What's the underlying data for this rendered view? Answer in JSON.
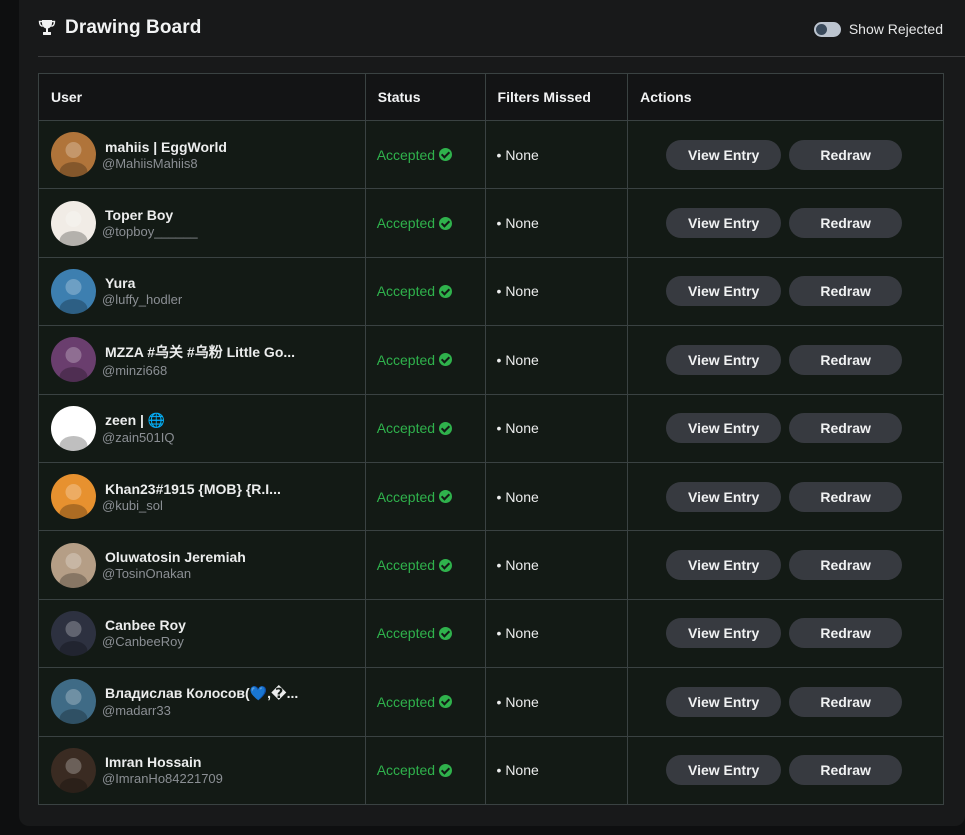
{
  "header": {
    "title": "Drawing Board",
    "toggle_label": "Show Rejected"
  },
  "table": {
    "columns": [
      "User",
      "Status",
      "Filters Missed",
      "Actions"
    ],
    "rows": [
      {
        "name": "mahiis | EggWorld",
        "handle": "@MahiisMahiis8",
        "status": "Accepted",
        "filters": "• None",
        "view": "View Entry",
        "redraw": "Redraw",
        "avatar": "#b0743a"
      },
      {
        "name": "Toper Boy",
        "handle": "@topboy______",
        "status": "Accepted",
        "filters": "• None",
        "view": "View Entry",
        "redraw": "Redraw",
        "avatar": "#f1ece6"
      },
      {
        "name": "Yura",
        "handle": "@luffy_hodler",
        "status": "Accepted",
        "filters": "• None",
        "view": "View Entry",
        "redraw": "Redraw",
        "avatar": "#3d7fb0"
      },
      {
        "name": "MZZA #乌关 #乌粉 Little Go...",
        "handle": "@minzi668",
        "status": "Accepted",
        "filters": "• None",
        "view": "View Entry",
        "redraw": "Redraw",
        "avatar": "#6a3e6e"
      },
      {
        "name": "zeen | 🌐",
        "handle": "@zain501IQ",
        "status": "Accepted",
        "filters": "• None",
        "view": "View Entry",
        "redraw": "Redraw",
        "avatar": "#ffffff"
      },
      {
        "name": "Khan23#1915 {MOB} {R.I...",
        "handle": "@kubi_sol",
        "status": "Accepted",
        "filters": "• None",
        "view": "View Entry",
        "redraw": "Redraw",
        "avatar": "#e7912f"
      },
      {
        "name": "Oluwatosin Jeremiah",
        "handle": "@TosinOnakan",
        "status": "Accepted",
        "filters": "• None",
        "view": "View Entry",
        "redraw": "Redraw",
        "avatar": "#b59e86"
      },
      {
        "name": "Canbee Roy",
        "handle": "@CanbeeRoy",
        "status": "Accepted",
        "filters": "• None",
        "view": "View Entry",
        "redraw": "Redraw",
        "avatar": "#2d3140"
      },
      {
        "name": "Владислав Колосов(💙,�...",
        "handle": "@madarr33",
        "status": "Accepted",
        "filters": "• None",
        "view": "View Entry",
        "redraw": "Redraw",
        "avatar": "#3f6b86"
      },
      {
        "name": "Imran Hossain",
        "handle": "@ImranHo84221709",
        "status": "Accepted",
        "filters": "• None",
        "view": "View Entry",
        "redraw": "Redraw",
        "avatar": "#3a2b22"
      }
    ]
  },
  "colors": {
    "accepted": "#2fb24c",
    "button_bg": "#373a40",
    "row_bg": "#131a15"
  }
}
